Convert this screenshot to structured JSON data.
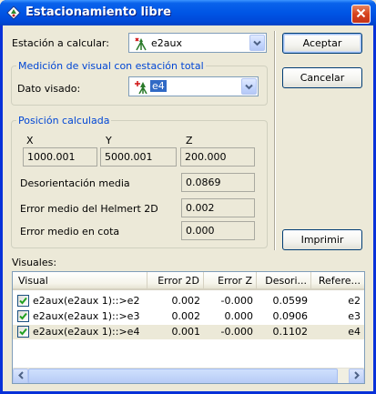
{
  "window": {
    "title": "Estacionamiento libre",
    "icon": "app-station-icon",
    "close_icon": "close-icon"
  },
  "station": {
    "label": "Estación a calcular:",
    "value": "e2aux",
    "icon": "station-tripod-icon"
  },
  "visual_group": {
    "title": "Medición de visual con estación total",
    "dato_label": "Dato visado:",
    "dato_value": "e4",
    "dato_icon": "target-prism-icon"
  },
  "position_group": {
    "title": "Posición calculada",
    "x_label": "X",
    "y_label": "Y",
    "z_label": "Z",
    "x_value": "1000.001",
    "y_value": "5000.001",
    "z_value": "200.000",
    "desorientacion_label": "Desorientación media",
    "desorientacion_value": "0.0869",
    "helmert_label": "Error medio del Helmert 2D",
    "helmert_value": "0.002",
    "cota_label": "Error medio en cota",
    "cota_value": "0.000"
  },
  "buttons": {
    "accept": "Aceptar",
    "cancel": "Cancelar",
    "print": "Imprimir"
  },
  "visuales": {
    "label": "Visuales:",
    "columns": [
      "Visual",
      "Error 2D",
      "Error Z",
      "Desori...",
      "Refere..."
    ],
    "rows": [
      {
        "checked": true,
        "visual": "e2aux(e2aux 1)::>e2",
        "error2d": "0.002",
        "errorz": "-0.000",
        "desori": "0.0599",
        "refere": "e2"
      },
      {
        "checked": true,
        "visual": "e2aux(e2aux 1)::>e3",
        "error2d": "0.002",
        "errorz": "0.000",
        "desori": "0.0906",
        "refere": "e3"
      },
      {
        "checked": true,
        "visual": "e2aux(e2aux 1)::>e4",
        "error2d": "0.001",
        "errorz": "-0.000",
        "desori": "0.1102",
        "refere": "e4"
      }
    ]
  },
  "colors": {
    "titlebar": "#0055e5",
    "group_title": "#0046d5",
    "selected_row": "#ece9d8",
    "dialog_bg": "#ece9d8"
  }
}
